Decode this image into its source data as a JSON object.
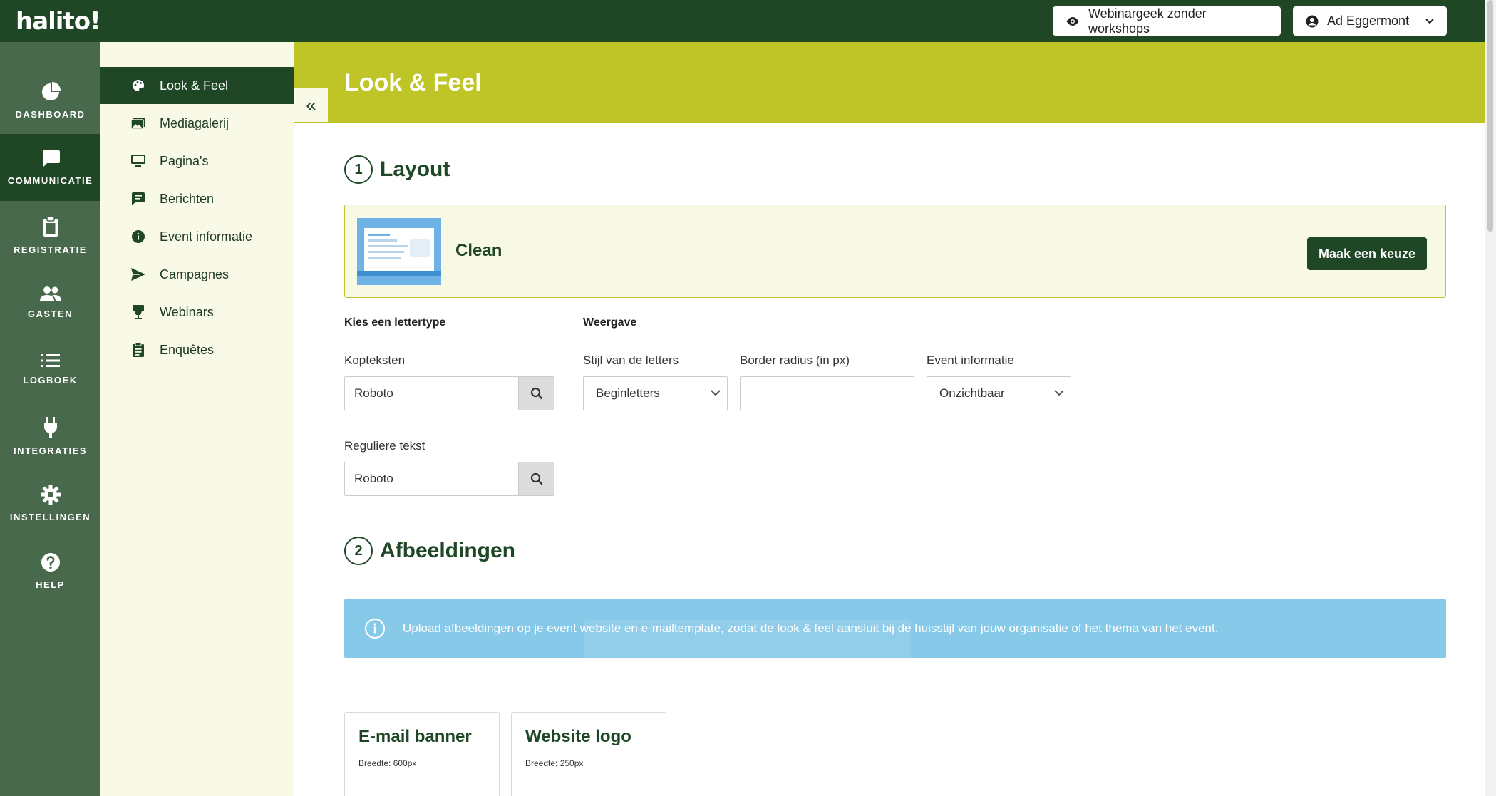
{
  "app": {
    "logo": "halito!"
  },
  "topbar": {
    "preview_label": "Webinargeek zonder workshops",
    "user_label": "Ad Eggermont"
  },
  "iconbar": {
    "items": [
      {
        "label": "DASHBOARD",
        "icon": "pie-chart-icon"
      },
      {
        "label": "COMMUNICATIE",
        "icon": "chat-icon",
        "active": true
      },
      {
        "label": "REGISTRATIE",
        "icon": "clipboard-icon"
      },
      {
        "label": "GASTEN",
        "icon": "users-icon"
      },
      {
        "label": "LOGBOEK",
        "icon": "list-icon"
      },
      {
        "label": "INTEGRATIES",
        "icon": "plug-icon"
      },
      {
        "label": "INSTELLINGEN",
        "icon": "gear-icon"
      },
      {
        "label": "HELP",
        "icon": "help-icon"
      }
    ]
  },
  "subnav": {
    "items": [
      {
        "label": "Look & Feel",
        "icon": "palette-icon",
        "active": true
      },
      {
        "label": "Mediagalerij",
        "icon": "images-icon"
      },
      {
        "label": "Pagina's",
        "icon": "monitor-icon"
      },
      {
        "label": "Berichten",
        "icon": "message-icon"
      },
      {
        "label": "Event informatie",
        "icon": "info-icon"
      },
      {
        "label": "Campagnes",
        "icon": "send-icon"
      },
      {
        "label": "Webinars",
        "icon": "presentation-icon"
      },
      {
        "label": "Enquêtes",
        "icon": "survey-icon"
      }
    ]
  },
  "page": {
    "title": "Look & Feel"
  },
  "layout_section": {
    "number": "1",
    "title": "Layout",
    "layout_name": "Clean",
    "choose_button": "Maak een keuze"
  },
  "font_group": {
    "label": "Kies een lettertype",
    "headings_label": "Kopteksten",
    "headings_value": "Roboto",
    "body_label": "Reguliere tekst",
    "body_value": "Roboto"
  },
  "display_group": {
    "label": "Weergave",
    "letter_style_label": "Stijl van de letters",
    "letter_style_value": "Beginletters",
    "border_radius_label": "Border radius (in px)",
    "border_radius_value": "",
    "event_info_label": "Event informatie",
    "event_info_value": "Onzichtbaar"
  },
  "images_section": {
    "number": "2",
    "title": "Afbeeldingen",
    "info_text": "Upload afbeeldingen op je event website en e-mailtemplate, zodat de look & feel aansluit bij de huisstijl van jouw organisatie of het thema van het event.",
    "cards": [
      {
        "title": "E-mail banner",
        "subtitle": "Breedte: 600px"
      },
      {
        "title": "Website logo",
        "subtitle": "Breedte: 250px"
      }
    ]
  },
  "colors": {
    "brand_dark": "#1f4726",
    "sidebar": "#48694c",
    "accent": "#c0c527",
    "info": "#86c9e8",
    "subnav_bg": "#f8f9e6"
  }
}
